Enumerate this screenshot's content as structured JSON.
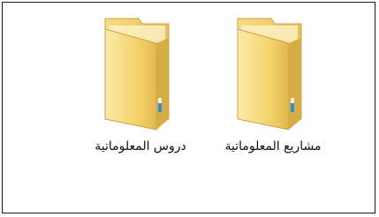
{
  "window": {
    "folders": [
      {
        "label": "مشاريع المعلوماتية",
        "icon": "folder-icon"
      },
      {
        "label": "دروس المعلوماتية",
        "icon": "folder-icon"
      }
    ]
  },
  "colors": {
    "folder_light": "#fbe9a4",
    "folder_mid": "#f2d36a",
    "folder_dark": "#d9b24a",
    "frame_border": "#1a1a1a",
    "tab_blue": "#2e8fd6"
  }
}
